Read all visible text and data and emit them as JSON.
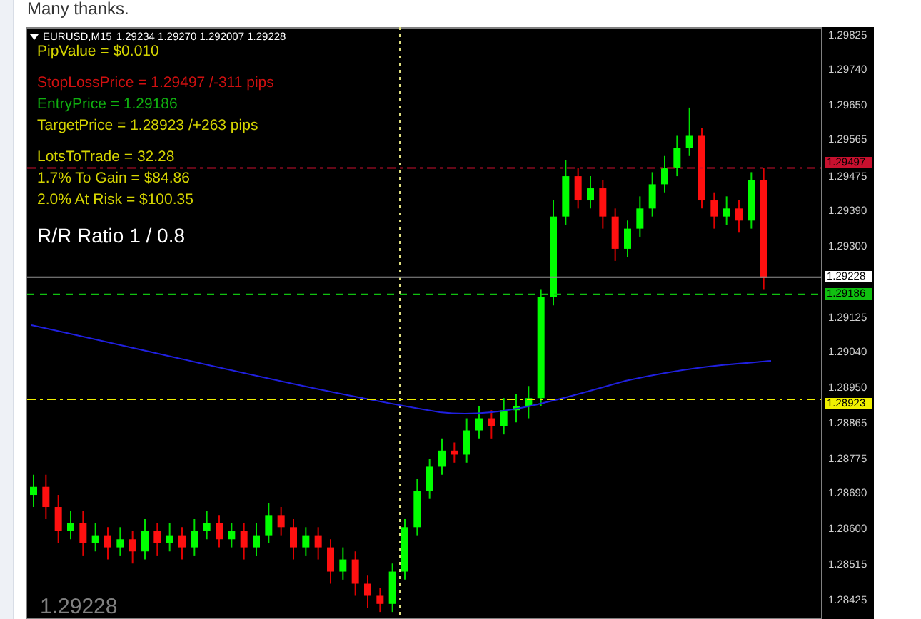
{
  "page_text": "Many thanks.",
  "chart": {
    "symbol": "EURUSD,M15",
    "ohlc": "1.29234 1.29270 1.292007 1.29228",
    "info_groups": [
      [
        {
          "text": "PipValue = $0.010",
          "color": "#d4d400"
        }
      ],
      [
        {
          "text": "StopLossPrice = 1.29497 /-311 pips",
          "color": "#d01010"
        },
        {
          "text": "EntryPrice = 1.29186",
          "color": "#10b010"
        },
        {
          "text": "TargetPrice = 1.28923 /+263 pips",
          "color": "#d4d400"
        }
      ],
      [
        {
          "text": "LotsToTrade = 32.28",
          "color": "#d4d400"
        },
        {
          "text": "1.7% To Gain =  $84.86",
          "color": "#d4d400"
        },
        {
          "text": "2.0% At Risk =  $100.35",
          "color": "#d4d400"
        }
      ]
    ],
    "ratio": "R/R Ratio  1 / 0.8",
    "levels": [
      {
        "label": "1.29497",
        "kind": "dashdot",
        "color": "#c8102e"
      },
      {
        "label": "1.29228",
        "kind": "solid",
        "color": "#ffffff"
      },
      {
        "label": "1.29186",
        "kind": "dashed",
        "color": "#10c010"
      },
      {
        "label": "1.28923",
        "kind": "dashdot",
        "color": "#f0f000"
      }
    ],
    "last_price": "1.29228",
    "chart_data": {
      "type": "candlestick",
      "ylim": [
        1.28379,
        1.29846
      ],
      "yticks": [
        {
          "value": 1.29825,
          "label": "1.29825"
        },
        {
          "value": 1.2974,
          "label": "1.29740"
        },
        {
          "value": 1.2965,
          "label": "1.29650"
        },
        {
          "value": 1.29565,
          "label": "1.29565"
        },
        {
          "value": 1.29475,
          "label": "1.29475"
        },
        {
          "value": 1.2939,
          "label": "1.29390"
        },
        {
          "value": 1.293,
          "label": "1.29300"
        },
        {
          "value": 1.29125,
          "label": "1.29125"
        },
        {
          "value": 1.2904,
          "label": "1.29040"
        },
        {
          "value": 1.2895,
          "label": "1.28950"
        },
        {
          "value": 1.28865,
          "label": "1.28865"
        },
        {
          "value": 1.28775,
          "label": "1.28775"
        },
        {
          "value": 1.2869,
          "label": "1.28690"
        },
        {
          "value": 1.286,
          "label": "1.28600"
        },
        {
          "value": 1.28515,
          "label": "1.28515"
        },
        {
          "value": 1.28425,
          "label": "1.28425"
        }
      ],
      "categories": [
        null,
        null,
        null,
        null,
        null,
        null,
        null,
        null,
        null,
        null,
        null,
        null,
        null,
        null,
        null,
        null,
        null,
        null,
        null,
        null,
        null,
        null,
        null,
        null,
        null,
        null,
        null,
        null,
        null,
        null,
        null,
        null,
        null,
        null,
        null,
        null,
        null,
        null,
        null,
        null,
        null,
        null,
        null,
        null,
        null,
        null,
        null,
        null,
        null,
        null,
        null,
        null,
        null,
        null,
        null,
        null,
        null,
        null,
        null,
        null
      ],
      "ohlc": [
        [
          1.2869,
          1.2874,
          1.2866,
          1.2871
        ],
        [
          1.2871,
          1.2874,
          1.2863,
          1.2866
        ],
        [
          1.2866,
          1.2869,
          1.2857,
          1.286
        ],
        [
          1.286,
          1.2865,
          1.2858,
          1.2862
        ],
        [
          1.2862,
          1.2865,
          1.2854,
          1.2857
        ],
        [
          1.2857,
          1.2862,
          1.2855,
          1.2859
        ],
        [
          1.2859,
          1.2861,
          1.2853,
          1.2856
        ],
        [
          1.2856,
          1.2861,
          1.2854,
          1.2858
        ],
        [
          1.2858,
          1.286,
          1.2852,
          1.2855
        ],
        [
          1.2855,
          1.2863,
          1.2853,
          1.286
        ],
        [
          1.286,
          1.2862,
          1.2854,
          1.2857
        ],
        [
          1.2857,
          1.2862,
          1.2855,
          1.2859
        ],
        [
          1.2859,
          1.2861,
          1.2853,
          1.2856
        ],
        [
          1.2856,
          1.2863,
          1.2854,
          1.286
        ],
        [
          1.286,
          1.2865,
          1.2858,
          1.2862
        ],
        [
          1.2862,
          1.2864,
          1.2856,
          1.2858
        ],
        [
          1.2858,
          1.2862,
          1.2856,
          1.286
        ],
        [
          1.286,
          1.2862,
          1.2853,
          1.2856
        ],
        [
          1.2856,
          1.2862,
          1.2854,
          1.2859
        ],
        [
          1.2859,
          1.2867,
          1.2857,
          1.2864
        ],
        [
          1.2864,
          1.2866,
          1.2859,
          1.2861
        ],
        [
          1.2861,
          1.2863,
          1.2853,
          1.2856
        ],
        [
          1.2856,
          1.2861,
          1.2854,
          1.2859
        ],
        [
          1.2859,
          1.2861,
          1.2853,
          1.2856
        ],
        [
          1.2856,
          1.2858,
          1.2847,
          1.285
        ],
        [
          1.285,
          1.2856,
          1.2848,
          1.2853
        ],
        [
          1.2853,
          1.2855,
          1.2844,
          1.2847
        ],
        [
          1.2847,
          1.2849,
          1.2841,
          1.2844
        ],
        [
          1.2844,
          1.2846,
          1.284,
          1.2842
        ],
        [
          1.2842,
          1.2852,
          1.284,
          1.285
        ],
        [
          1.285,
          1.2863,
          1.2848,
          1.2861
        ],
        [
          1.2861,
          1.2873,
          1.2859,
          1.287
        ],
        [
          1.287,
          1.2878,
          1.2868,
          1.2876
        ],
        [
          1.2876,
          1.2883,
          1.2874,
          1.288
        ],
        [
          1.288,
          1.2882,
          1.2877,
          1.2879
        ],
        [
          1.2879,
          1.2888,
          1.2877,
          1.2885
        ],
        [
          1.2885,
          1.2891,
          1.2883,
          1.2888
        ],
        [
          1.2888,
          1.289,
          1.2883,
          1.2886
        ],
        [
          1.2886,
          1.2893,
          1.2884,
          1.289
        ],
        [
          1.289,
          1.2894,
          1.2887,
          1.2891
        ],
        [
          1.2891,
          1.2896,
          1.2888,
          1.2893
        ],
        [
          1.2893,
          1.292,
          1.2891,
          1.2918
        ],
        [
          1.2918,
          1.2942,
          1.2916,
          1.2938
        ],
        [
          1.2938,
          1.2952,
          1.2936,
          1.2948
        ],
        [
          1.2948,
          1.295,
          1.294,
          1.2942
        ],
        [
          1.2942,
          1.2948,
          1.294,
          1.2945
        ],
        [
          1.2945,
          1.2947,
          1.2935,
          1.2938
        ],
        [
          1.2938,
          1.294,
          1.2927,
          1.293
        ],
        [
          1.293,
          1.2937,
          1.2928,
          1.2935
        ],
        [
          1.2935,
          1.2943,
          1.2933,
          1.294
        ],
        [
          1.294,
          1.2949,
          1.2938,
          1.2946
        ],
        [
          1.2946,
          1.2953,
          1.2944,
          1.295
        ],
        [
          1.295,
          1.2958,
          1.2948,
          1.2955
        ],
        [
          1.2955,
          1.2965,
          1.2953,
          1.2958
        ],
        [
          1.2958,
          1.296,
          1.294,
          1.2942
        ],
        [
          1.2942,
          1.2944,
          1.2935,
          1.2938
        ],
        [
          1.2938,
          1.2943,
          1.2936,
          1.294
        ],
        [
          1.294,
          1.2942,
          1.2934,
          1.2937
        ],
        [
          1.2937,
          1.2949,
          1.2935,
          1.2947
        ],
        [
          1.2947,
          1.295,
          1.292,
          1.29228
        ]
      ]
    }
  }
}
